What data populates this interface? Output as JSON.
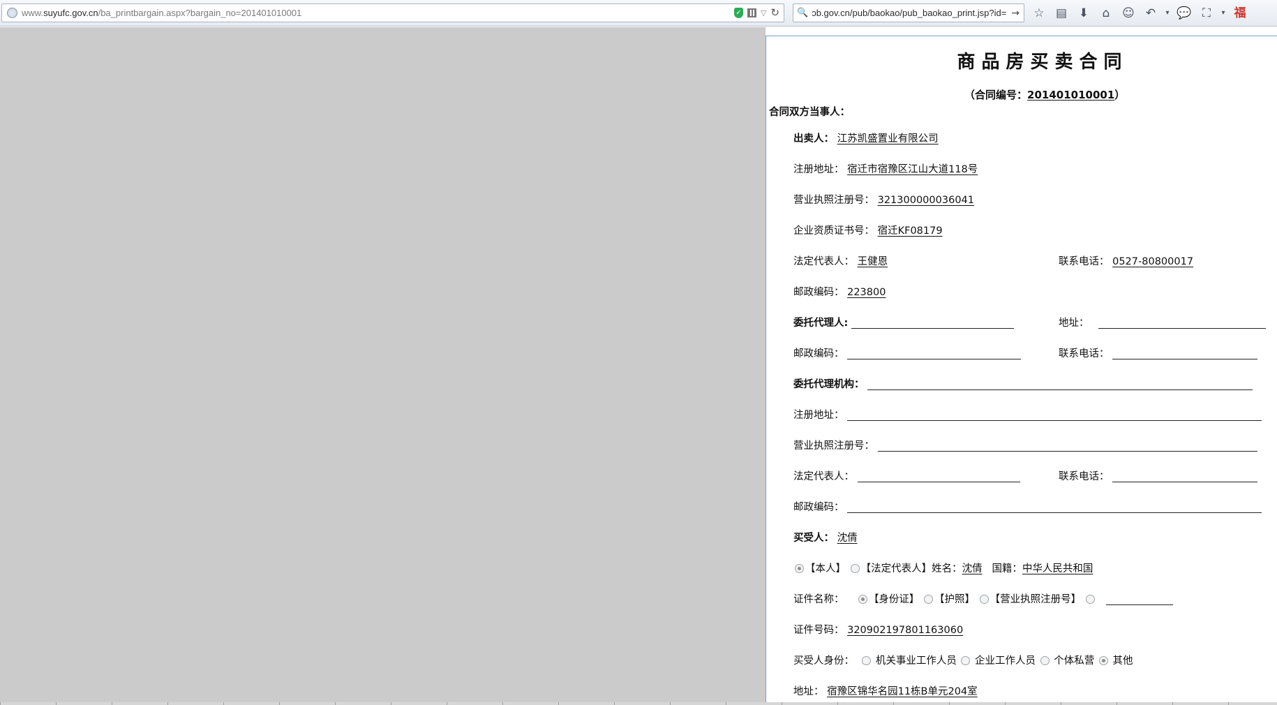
{
  "browser": {
    "url_host": "www.suyufc.gov.cn",
    "url_prefix": "www.",
    "url_domain": "suyufc.gov.cn",
    "url_path": "/ba_printbargain.aspx?bargain_no=201401010001",
    "search_text": "ɔb.gov.cn/pub/baokao/pub_baokao_print.jsp?id=",
    "search_go_icon": "→",
    "reload_icon": "↻",
    "toolbar_icons": [
      "☆",
      "▤",
      "⬇",
      "⌂",
      "☺",
      "↶",
      "▾",
      "💬",
      "⛶",
      "▾",
      "福"
    ]
  },
  "doc": {
    "title": "商品房买卖合同",
    "contract_no_prefix": "（合同编号：",
    "contract_no": "201401010001",
    "contract_no_suffix": "）",
    "parties_heading": "合同双方当事人：",
    "seller": {
      "label": "出卖人：",
      "name": "江苏凯盛置业有限公司",
      "reg_addr_label": "注册地址：",
      "reg_addr": "宿迁市宿豫区江山大道118号",
      "license_label": "营业执照注册号：",
      "license": "321300000036041",
      "qual_label": "企业资质证书号：",
      "qual": "宿迁KF08179",
      "legal_rep_label": "法定代表人：",
      "legal_rep": "王健恩",
      "phone_label": "联系电话：",
      "phone": "0527-80800017",
      "postcode_label": "邮政编码：",
      "postcode": "223800"
    },
    "agent": {
      "label": "委托代理人:",
      "addr_label": "地址：",
      "postcode_label": "邮政编码：",
      "phone_label": "联系电话："
    },
    "agency": {
      "label": "委托代理机构：",
      "reg_addr_label": "注册地址：",
      "license_label": "营业执照注册号：",
      "legal_rep_label": "法定代表人：",
      "phone_label": "联系电话：",
      "postcode_label": "邮政编码："
    },
    "buyer": {
      "label": "买受人：",
      "name": "沈倩",
      "opt_self": "【本人】",
      "opt_legal": "【法定代表人】",
      "name_label": "姓名：",
      "name2": "沈倩",
      "nationality_label": "国籍：",
      "nationality": "中华人民共和国",
      "id_type_label": "证件名称：",
      "id_opt_1": "【身份证】",
      "id_opt_2": "【护照】",
      "id_opt_3": "【营业执照注册号】",
      "id_no_label": "证件号码：",
      "id_no": "320902197801163060",
      "identity_label": "买受人身份：",
      "identity_opt_1": "机关事业工作人员",
      "identity_opt_2": "企业工作人员",
      "identity_opt_3": "个体私营",
      "identity_opt_4": "其他",
      "addr_label": "地址：",
      "addr": "宿豫区锦华名园11栋B单元204室"
    }
  }
}
